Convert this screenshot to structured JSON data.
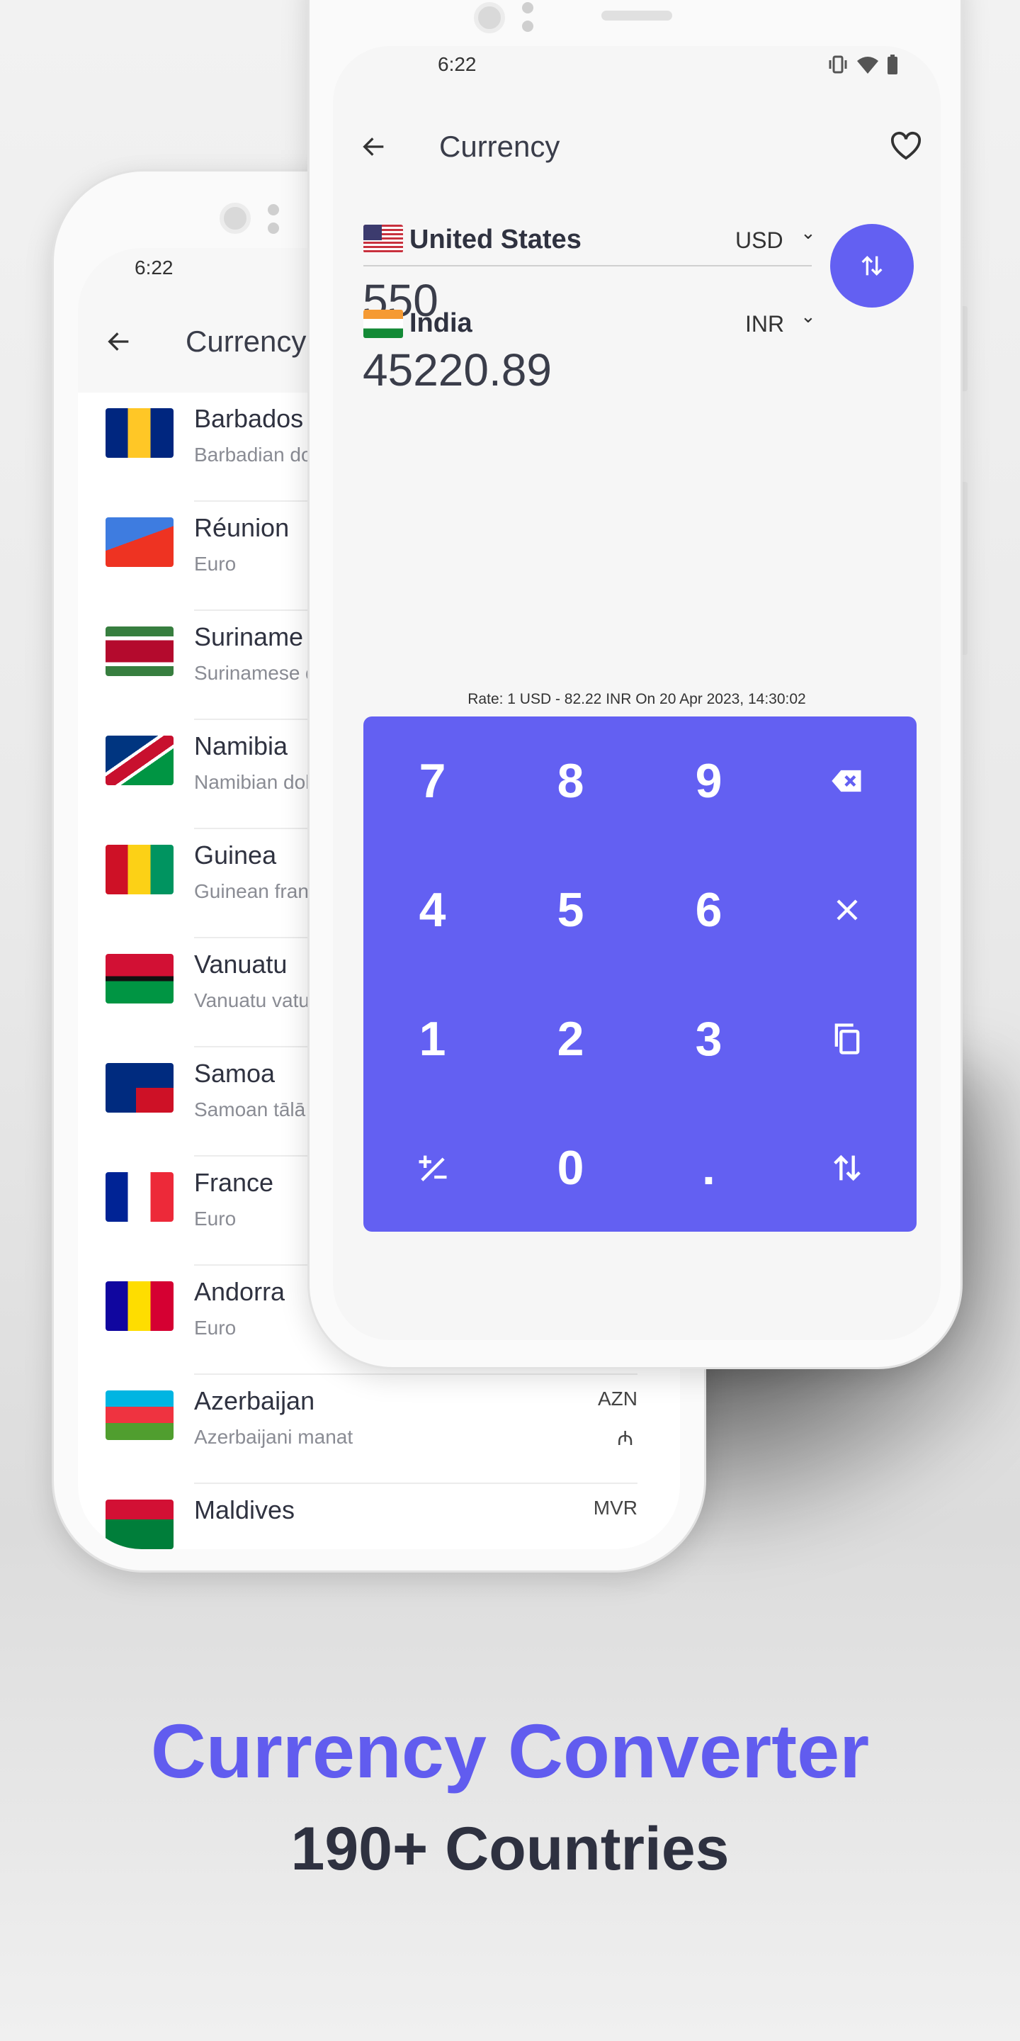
{
  "back_phone": {
    "status_time": "6:22",
    "header_title": "Currency",
    "list": [
      {
        "country": "Barbados",
        "currency": "Barbadian dollar",
        "flag": "barbados"
      },
      {
        "country": "Réunion",
        "currency": "Euro",
        "flag": "reunion"
      },
      {
        "country": "Suriname",
        "currency": "Surinamese dollar",
        "flag": "suriname"
      },
      {
        "country": "Namibia",
        "currency": "Namibian dollar",
        "flag": "namibia"
      },
      {
        "country": "Guinea",
        "currency": "Guinean franc",
        "flag": "guinea"
      },
      {
        "country": "Vanuatu",
        "currency": "Vanuatu vatu",
        "flag": "vanuatu"
      },
      {
        "country": "Samoa",
        "currency": "Samoan tālā",
        "flag": "samoa"
      },
      {
        "country": "France",
        "currency": "Euro",
        "flag": "france"
      },
      {
        "country": "Andorra",
        "currency": "Euro",
        "flag": "andorra"
      },
      {
        "country": "Azerbaijan",
        "currency": "Azerbaijani manat",
        "flag": "azerbaijan",
        "code": "AZN",
        "symbol": "₼"
      },
      {
        "country": "Maldives",
        "currency": "",
        "flag": "maldives",
        "code": "MVR"
      }
    ]
  },
  "front_phone": {
    "status_time": "6:22",
    "header_title": "Currency",
    "from": {
      "country": "United States",
      "code": "USD",
      "amount": "550"
    },
    "to": {
      "country": "India",
      "code": "INR",
      "amount": "45220.89"
    },
    "rate": "Rate: 1 USD - 82.22 INR On 20 Apr 2023, 14:30:02",
    "keypad": [
      [
        "7",
        "8",
        "9",
        "backspace-icon"
      ],
      [
        "4",
        "5",
        "6",
        "multiply-icon"
      ],
      [
        "1",
        "2",
        "3",
        "copy-icon"
      ],
      [
        "plus-minus-icon",
        "0",
        ".",
        "swap-icon"
      ]
    ]
  },
  "promo": {
    "title": "Currency Converter",
    "subtitle": "190+ Countries"
  },
  "colors": {
    "accent": "#6360f2",
    "text_dark": "#2e3140"
  }
}
